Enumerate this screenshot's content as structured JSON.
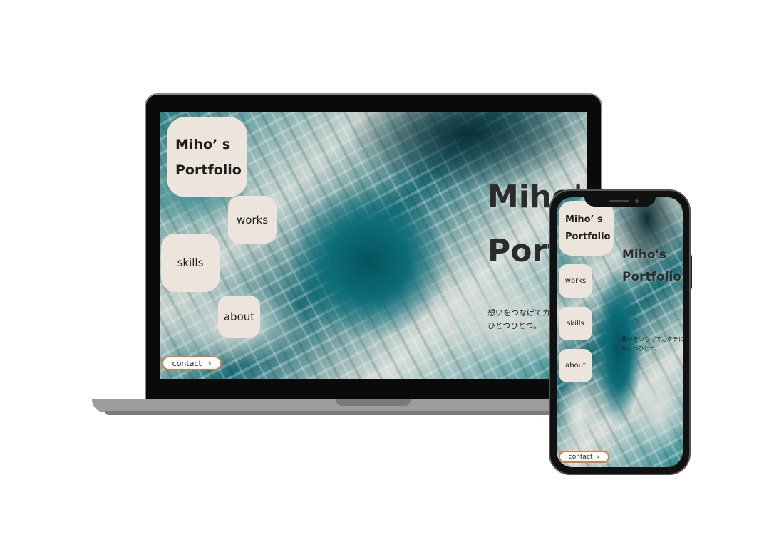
{
  "laptop": {
    "brand_title": [
      "Miho’ s",
      "Portfolio"
    ],
    "nav": {
      "works": "works",
      "skills": "skills",
      "about": "about"
    },
    "contact": "contact",
    "contact_icon": "chevron-right-icon",
    "hero_title": [
      "Miho's",
      "Portfolio"
    ],
    "tagline": [
      "想いをつなげてカタチにします。",
      "ひとつひとつ。"
    ]
  },
  "phone": {
    "brand_title": [
      "Miho’ s",
      "Portfolio"
    ],
    "nav": {
      "works": "works",
      "skills": "skills",
      "about": "about"
    },
    "contact": "contact",
    "contact_icon": "chevron-right-icon",
    "hero_title": [
      "Miho's",
      "Portfolio"
    ],
    "tagline": [
      "想いをつなげてカタチにします。",
      "ひとつひとつ。"
    ]
  },
  "colors": {
    "card_bg": "#ede5db",
    "contact_border": "#d97a45",
    "marble_dark": "#07525f",
    "marble_light": "#e6e7e2"
  }
}
